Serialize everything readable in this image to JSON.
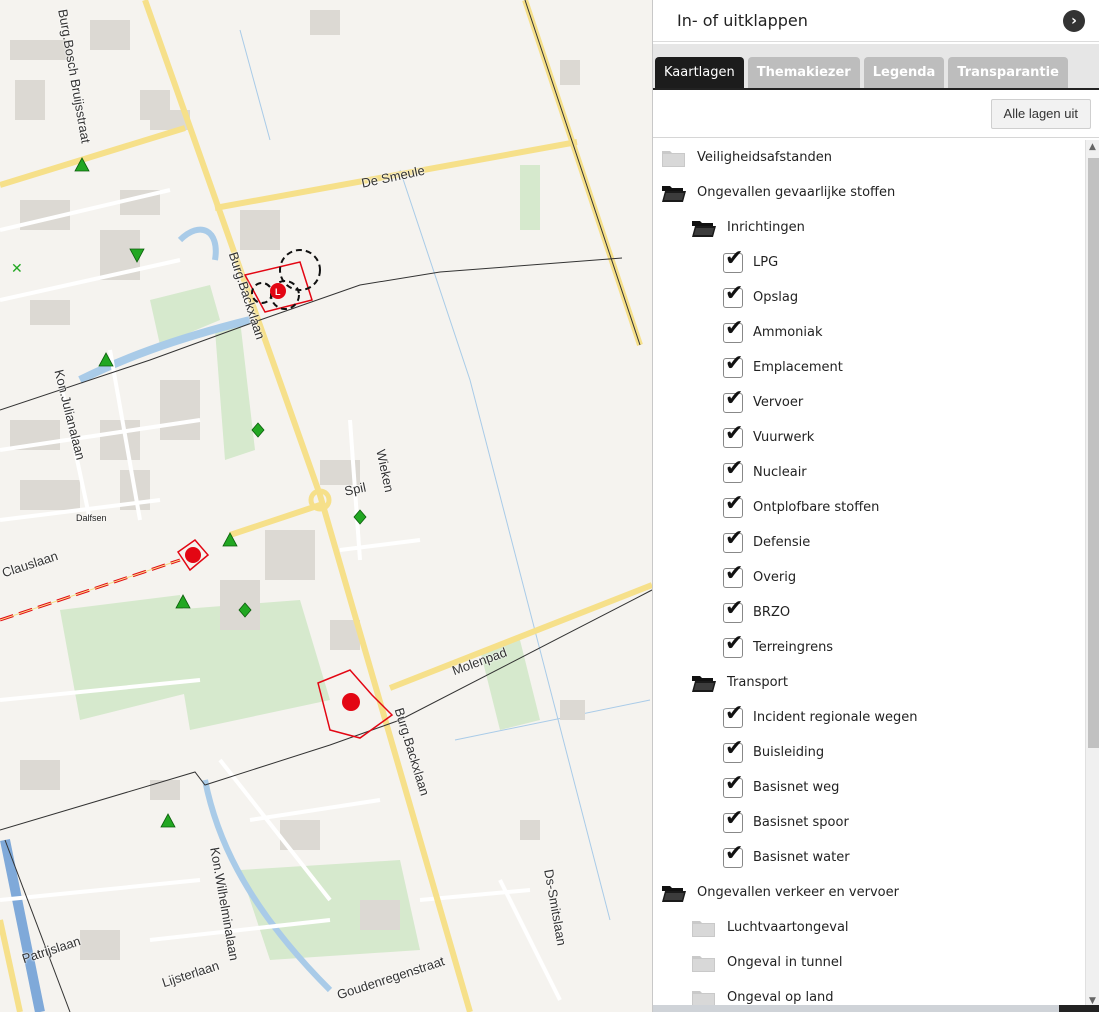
{
  "panel": {
    "title": "In- of uitklappen",
    "collapse_icon": "chevron-right-icon",
    "tabs": [
      {
        "label": "Kaartlagen",
        "active": true
      },
      {
        "label": "Themakiezer",
        "active": false
      },
      {
        "label": "Legenda",
        "active": false
      },
      {
        "label": "Transparantie",
        "active": false
      }
    ],
    "all_layers_off": "Alle lagen uit",
    "tree": [
      {
        "type": "folder",
        "state": "closed",
        "label": "Veiligheidsafstanden"
      },
      {
        "type": "folder",
        "state": "open",
        "label": "Ongevallen gevaarlijke stoffen"
      },
      {
        "type": "subfolder",
        "state": "open",
        "label": "Inrichtingen"
      },
      {
        "type": "layer",
        "checked": true,
        "label": "LPG"
      },
      {
        "type": "layer",
        "checked": true,
        "label": "Opslag"
      },
      {
        "type": "layer",
        "checked": true,
        "label": "Ammoniak"
      },
      {
        "type": "layer",
        "checked": true,
        "label": "Emplacement"
      },
      {
        "type": "layer",
        "checked": true,
        "label": "Vervoer"
      },
      {
        "type": "layer",
        "checked": true,
        "label": "Vuurwerk"
      },
      {
        "type": "layer",
        "checked": true,
        "label": "Nucleair"
      },
      {
        "type": "layer",
        "checked": true,
        "label": "Ontplofbare stoffen"
      },
      {
        "type": "layer",
        "checked": true,
        "label": "Defensie"
      },
      {
        "type": "layer",
        "checked": true,
        "label": "Overig"
      },
      {
        "type": "layer",
        "checked": true,
        "label": "BRZO"
      },
      {
        "type": "layer",
        "checked": true,
        "label": "Terreingrens"
      },
      {
        "type": "subfolder",
        "state": "open",
        "label": "Transport"
      },
      {
        "type": "layer",
        "checked": true,
        "label": "Incident regionale wegen"
      },
      {
        "type": "layer",
        "checked": true,
        "label": "Buisleiding"
      },
      {
        "type": "layer",
        "checked": true,
        "label": "Basisnet weg"
      },
      {
        "type": "layer",
        "checked": true,
        "label": "Basisnet spoor"
      },
      {
        "type": "layer",
        "checked": true,
        "label": "Basisnet water"
      },
      {
        "type": "folder",
        "state": "open",
        "label": "Ongevallen verkeer en vervoer"
      },
      {
        "type": "subfolder",
        "state": "closed",
        "label": "Luchtvaartongeval"
      },
      {
        "type": "subfolder",
        "state": "closed",
        "label": "Ongeval in tunnel"
      },
      {
        "type": "subfolder",
        "state": "closed",
        "label": "Ongeval op land"
      }
    ]
  },
  "map": {
    "streets": [
      "Burg.Bosch Bruijsstraat",
      "De Smeule",
      "Burg.Backxlaan",
      "Kon.Julianalaan",
      "Wieken",
      "Spil",
      "Clauslaan",
      "Molenpad",
      "Burg.Backxlaan",
      "Kon.Wilhelminalaan",
      "Ds-Smitslaan",
      "Patrijslaan",
      "Lijsterlaan",
      "Goudenregenstraat"
    ],
    "places": [
      "Dalfsen"
    ],
    "colors": {
      "main_road": "#f6e08a",
      "water": "#a9cbe8",
      "green": "#cfe6c4",
      "building": "#d9d6d0",
      "hazard": "#e30613",
      "marker": "#22a722"
    }
  }
}
